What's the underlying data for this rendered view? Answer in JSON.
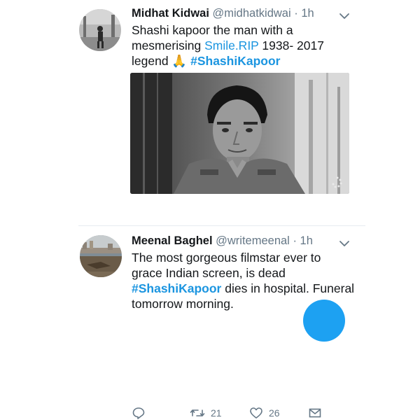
{
  "tweets": [
    {
      "author_name": "Midhat Kidwai",
      "handle": "@midhatkidwai",
      "separator": "·",
      "time": "1h",
      "line1": "Shashi kapoor the man with a",
      "line2_pre": "mesmerising ",
      "line2_link": "Smile.RIP",
      "line2_post": " 1938- 2017",
      "line3_pre": "legend ",
      "line3_emoji": "🙏",
      "line3_hashtag": "#ShashiKapoor",
      "retweets": "21",
      "likes": "26"
    },
    {
      "author_name": "Meenal Baghel",
      "handle": "@writemeenal",
      "separator": "·",
      "time": "1h",
      "line1": "The most gorgeous filmstar ever to",
      "line2": "grace Indian screen, is dead",
      "line3_hashtag": "#ShashiKapoor",
      "line3_post": " dies in hospital. Funeral",
      "line4": "tomorrow morning."
    }
  ],
  "colors": {
    "link": "#1b95e0",
    "muted": "#657786",
    "accent": "#1da1f2",
    "divider": "#e6ecf0"
  },
  "icons": [
    "chevron-down-icon",
    "reply-icon",
    "retweet-icon",
    "like-icon",
    "direct-message-icon"
  ]
}
